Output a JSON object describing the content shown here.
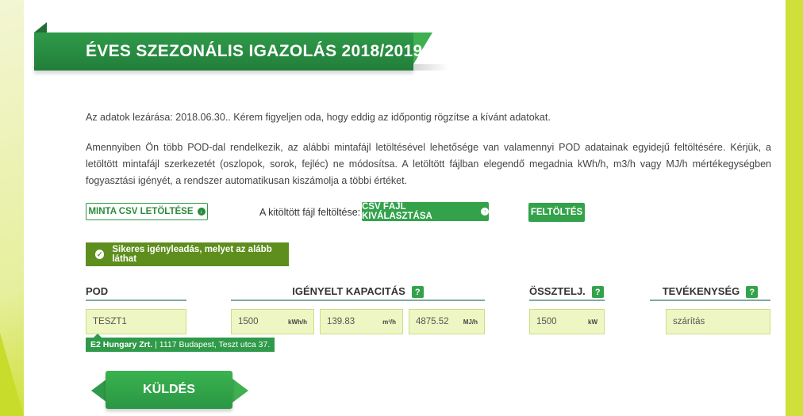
{
  "header": {
    "title": "ÉVES SZEZONÁLIS IGAZOLÁS 2018/2019"
  },
  "intro": {
    "deadline_text": "Az adatok lezárása: 2018.06.30.. Kérem figyeljen oda, hogy eddig az időpontig rögzítse a kívánt adatokat.",
    "description": "Amennyiben Ön több POD-dal rendelkezik, az alábbi mintafájl letöltésével lehetősége van valamennyi POD adatainak egyidejű feltöltésére. Kérjük, a letöltött mintafájl szerkezetét (oszlopok, sorok, fejléc) ne módosítsa. A letöltött fájlban elegendő megadnia kWh/h, m3/h vagy MJ/h mértékegységben fogyasztási igényét, a rendszer automatikusan kiszámolja a többi értéket."
  },
  "actions": {
    "download_label": "MINTA CSV LETÖLTÉSE",
    "upload_prompt": "A kitöltött fájl feltöltése:",
    "select_csv_label": "CSV FÁJL KIVÁLASZTÁSA",
    "upload_label": "FELTÖLTÉS"
  },
  "success_message": "Sikeres igényleadás, melyet az alább láthat",
  "columns": {
    "pod": "POD",
    "capacity": "IGÉNYELT KAPACITÁS",
    "total": "ÖSSZTELJ.",
    "activity": "TEVÉKENYSÉG",
    "help_glyph": "?"
  },
  "row": {
    "pod": "TESZT1",
    "kwh": {
      "value": "1500",
      "unit": "kWh/h"
    },
    "m3": {
      "value": "139.83",
      "unit": "m³/h"
    },
    "mj": {
      "value": "4875.52",
      "unit": "MJ/h"
    },
    "total": {
      "value": "1500",
      "unit": "kW"
    },
    "activity": "szárítás"
  },
  "tooltip": {
    "company": "E2 Hungary Zrt.",
    "address": "| 1117 Budapest, Teszt utca 37."
  },
  "submit_label": "KÜLDÉS",
  "icons": {
    "download": "arrow-down-circle-icon",
    "upload": "arrow-up-circle-icon",
    "success": "check-circle-icon",
    "help": "question-icon"
  },
  "colors": {
    "brand_green": "#2f9a49",
    "success_bg": "#5e8e1d",
    "field_bg": "#eef7c3",
    "accent_lime": "#cfe03a"
  }
}
